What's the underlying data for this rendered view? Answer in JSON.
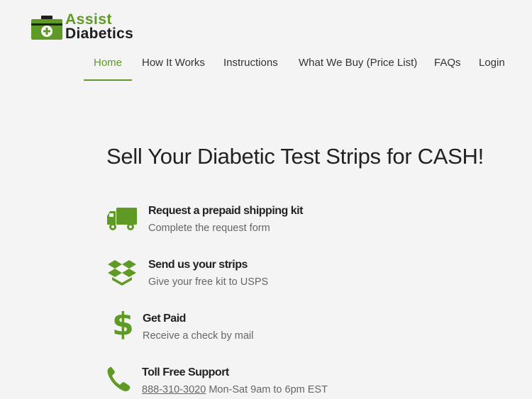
{
  "logo": {
    "line1": "Assist",
    "line2": "Diabetics"
  },
  "nav": {
    "items": [
      {
        "label": "Home",
        "active": true
      },
      {
        "label": "How It Works"
      },
      {
        "label": "Instructions"
      },
      {
        "label": "What We Buy (Price List)"
      },
      {
        "label": "FAQs"
      },
      {
        "label": "Login"
      }
    ]
  },
  "main": {
    "headline": "Sell Your Diabetic Test Strips for CASH!",
    "steps": [
      {
        "icon": "truck-icon",
        "title": "Request a prepaid shipping kit",
        "desc": "Complete the request form"
      },
      {
        "icon": "box-icon",
        "title": "Send us your strips",
        "desc": "Give your free kit to USPS"
      },
      {
        "icon": "dollar-icon",
        "title": "Get Paid",
        "desc": "Receive a check by mail"
      },
      {
        "icon": "phone-icon",
        "title": "Toll Free Support",
        "phone": "888-310-3020",
        "desc": " Mon-Sat 9am to 6pm EST"
      }
    ]
  },
  "colors": {
    "accent": "#5f9a26",
    "background": "#f4f4f4",
    "text": "#222222",
    "muted": "#666666"
  }
}
